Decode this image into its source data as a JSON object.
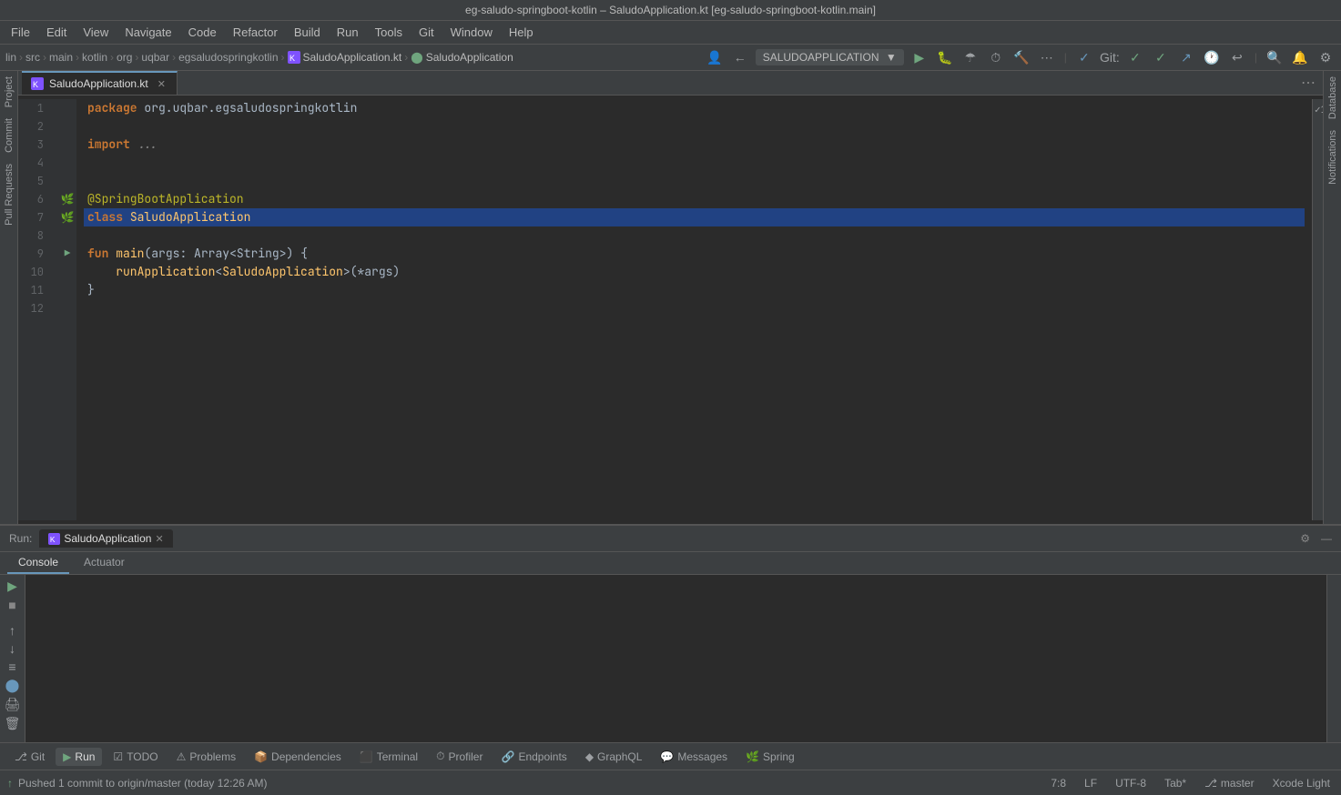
{
  "window": {
    "title": "eg-saludo-springboot-kotlin – SaludoApplication.kt [eg-saludo-springboot-kotlin.main]"
  },
  "menu": {
    "items": [
      "File",
      "Edit",
      "View",
      "Navigate",
      "Code",
      "Refactor",
      "Build",
      "Run",
      "Tools",
      "Git",
      "Window",
      "Help"
    ]
  },
  "breadcrumb": {
    "items": [
      "lin",
      "src",
      "main",
      "kotlin",
      "org",
      "uqbar",
      "egsaludospringkotlin"
    ],
    "file": "SaludoApplication.kt",
    "class": "SaludoApplication"
  },
  "run_config": {
    "name": "SALUDOAPPLICATION",
    "dropdown_arrow": "▼"
  },
  "editor": {
    "tab": {
      "name": "SaludoApplication.kt",
      "icon": "kotlin-file"
    },
    "lines": [
      {
        "num": 1,
        "content": "package org.uqbar.egsaludospringkotlin",
        "tokens": [
          {
            "t": "kw",
            "v": "package"
          },
          {
            "t": "punc",
            "v": " org.uqbar.egsaludospringkotlin"
          }
        ]
      },
      {
        "num": 2,
        "content": "",
        "tokens": []
      },
      {
        "num": 3,
        "content": "import ...",
        "tokens": [
          {
            "t": "kw",
            "v": "import"
          },
          {
            "t": "punc",
            "v": " ..."
          }
        ]
      },
      {
        "num": 4,
        "content": "",
        "tokens": []
      },
      {
        "num": 5,
        "content": "",
        "tokens": []
      },
      {
        "num": 6,
        "content": "@SpringBootApplication",
        "tokens": [
          {
            "t": "annotation",
            "v": "@SpringBootApplication"
          }
        ]
      },
      {
        "num": 7,
        "content": "class SaludoApplication",
        "tokens": [
          {
            "t": "kw",
            "v": "class"
          },
          {
            "t": "punc",
            "v": " "
          },
          {
            "t": "class-name",
            "v": "SaludoApplication"
          }
        ]
      },
      {
        "num": 8,
        "content": "",
        "tokens": []
      },
      {
        "num": 9,
        "content": "fun main(args: Array<String>) {",
        "tokens": [
          {
            "t": "kw",
            "v": "fun"
          },
          {
            "t": "punc",
            "v": " "
          },
          {
            "t": "fn-name",
            "v": "main"
          },
          {
            "t": "punc",
            "v": "("
          },
          {
            "t": "param",
            "v": "args"
          },
          {
            "t": "punc",
            "v": ": "
          },
          {
            "t": "type-name",
            "v": "Array"
          },
          {
            "t": "punc",
            "v": "<"
          },
          {
            "t": "type-name",
            "v": "String"
          },
          {
            "t": "punc",
            "v": ">) {"
          }
        ]
      },
      {
        "num": 10,
        "content": "    runApplication<SaludoApplication>(*args)",
        "tokens": [
          {
            "t": "punc",
            "v": "    "
          },
          {
            "t": "method",
            "v": "runApplication"
          },
          {
            "t": "punc",
            "v": "<"
          },
          {
            "t": "class-name",
            "v": "SaludoApplication"
          },
          {
            "t": "punc",
            "v": ">(*args)"
          }
        ]
      },
      {
        "num": 11,
        "content": "}",
        "tokens": [
          {
            "t": "punc",
            "v": "}"
          }
        ]
      },
      {
        "num": 12,
        "content": "",
        "tokens": []
      }
    ],
    "selected_line": 7
  },
  "run_panel": {
    "label": "Run:",
    "tab_name": "SaludoApplication",
    "tabs": [
      "Console",
      "Actuator"
    ],
    "active_tab": "Console"
  },
  "status_bar": {
    "git_status": "Pushed 1 commit to origin/master (today 12:26 AM)",
    "position": "7:8",
    "encoding": "UTF-8",
    "indent": "Tab*",
    "branch": "master",
    "theme": "Xcode Light"
  },
  "bottom_toolbar": {
    "items": [
      {
        "icon": "git-icon",
        "label": "Git"
      },
      {
        "icon": "run-icon",
        "label": "Run",
        "active": true
      },
      {
        "icon": "todo-icon",
        "label": "TODO"
      },
      {
        "icon": "problems-icon",
        "label": "Problems"
      },
      {
        "icon": "dependencies-icon",
        "label": "Dependencies"
      },
      {
        "icon": "terminal-icon",
        "label": "Terminal"
      },
      {
        "icon": "profiler-icon",
        "label": "Profiler"
      },
      {
        "icon": "endpoints-icon",
        "label": "Endpoints"
      },
      {
        "icon": "graphql-icon",
        "label": "GraphQL"
      },
      {
        "icon": "messages-icon",
        "label": "Messages"
      },
      {
        "icon": "spring-icon",
        "label": "Spring"
      }
    ]
  },
  "sidebar_panels": {
    "left": [
      "Project",
      "Commit",
      "Pull Requests"
    ],
    "right": [
      "Database",
      "Notifications"
    ]
  },
  "icons": {
    "run": "▶",
    "stop": "■",
    "rerun": "↺",
    "close": "✕",
    "settings": "⚙",
    "arrow_up": "↑",
    "arrow_down": "↓",
    "fold": "≡",
    "spring": "🌿",
    "kotlin": "K"
  }
}
